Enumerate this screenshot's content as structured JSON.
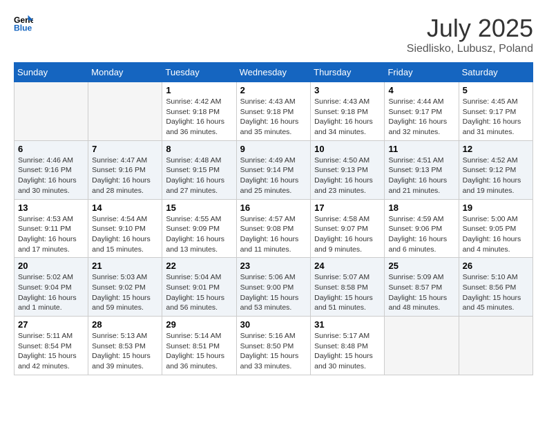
{
  "logo": {
    "line1": "General",
    "line2": "Blue"
  },
  "title": {
    "month_year": "July 2025",
    "location": "Siedlisko, Lubusz, Poland"
  },
  "days_of_week": [
    "Sunday",
    "Monday",
    "Tuesday",
    "Wednesday",
    "Thursday",
    "Friday",
    "Saturday"
  ],
  "weeks": [
    [
      {
        "day": "",
        "info": ""
      },
      {
        "day": "",
        "info": ""
      },
      {
        "day": "1",
        "info": "Sunrise: 4:42 AM\nSunset: 9:18 PM\nDaylight: 16 hours and 36 minutes."
      },
      {
        "day": "2",
        "info": "Sunrise: 4:43 AM\nSunset: 9:18 PM\nDaylight: 16 hours and 35 minutes."
      },
      {
        "day": "3",
        "info": "Sunrise: 4:43 AM\nSunset: 9:18 PM\nDaylight: 16 hours and 34 minutes."
      },
      {
        "day": "4",
        "info": "Sunrise: 4:44 AM\nSunset: 9:17 PM\nDaylight: 16 hours and 32 minutes."
      },
      {
        "day": "5",
        "info": "Sunrise: 4:45 AM\nSunset: 9:17 PM\nDaylight: 16 hours and 31 minutes."
      }
    ],
    [
      {
        "day": "6",
        "info": "Sunrise: 4:46 AM\nSunset: 9:16 PM\nDaylight: 16 hours and 30 minutes."
      },
      {
        "day": "7",
        "info": "Sunrise: 4:47 AM\nSunset: 9:16 PM\nDaylight: 16 hours and 28 minutes."
      },
      {
        "day": "8",
        "info": "Sunrise: 4:48 AM\nSunset: 9:15 PM\nDaylight: 16 hours and 27 minutes."
      },
      {
        "day": "9",
        "info": "Sunrise: 4:49 AM\nSunset: 9:14 PM\nDaylight: 16 hours and 25 minutes."
      },
      {
        "day": "10",
        "info": "Sunrise: 4:50 AM\nSunset: 9:13 PM\nDaylight: 16 hours and 23 minutes."
      },
      {
        "day": "11",
        "info": "Sunrise: 4:51 AM\nSunset: 9:13 PM\nDaylight: 16 hours and 21 minutes."
      },
      {
        "day": "12",
        "info": "Sunrise: 4:52 AM\nSunset: 9:12 PM\nDaylight: 16 hours and 19 minutes."
      }
    ],
    [
      {
        "day": "13",
        "info": "Sunrise: 4:53 AM\nSunset: 9:11 PM\nDaylight: 16 hours and 17 minutes."
      },
      {
        "day": "14",
        "info": "Sunrise: 4:54 AM\nSunset: 9:10 PM\nDaylight: 16 hours and 15 minutes."
      },
      {
        "day": "15",
        "info": "Sunrise: 4:55 AM\nSunset: 9:09 PM\nDaylight: 16 hours and 13 minutes."
      },
      {
        "day": "16",
        "info": "Sunrise: 4:57 AM\nSunset: 9:08 PM\nDaylight: 16 hours and 11 minutes."
      },
      {
        "day": "17",
        "info": "Sunrise: 4:58 AM\nSunset: 9:07 PM\nDaylight: 16 hours and 9 minutes."
      },
      {
        "day": "18",
        "info": "Sunrise: 4:59 AM\nSunset: 9:06 PM\nDaylight: 16 hours and 6 minutes."
      },
      {
        "day": "19",
        "info": "Sunrise: 5:00 AM\nSunset: 9:05 PM\nDaylight: 16 hours and 4 minutes."
      }
    ],
    [
      {
        "day": "20",
        "info": "Sunrise: 5:02 AM\nSunset: 9:04 PM\nDaylight: 16 hours and 1 minute."
      },
      {
        "day": "21",
        "info": "Sunrise: 5:03 AM\nSunset: 9:02 PM\nDaylight: 15 hours and 59 minutes."
      },
      {
        "day": "22",
        "info": "Sunrise: 5:04 AM\nSunset: 9:01 PM\nDaylight: 15 hours and 56 minutes."
      },
      {
        "day": "23",
        "info": "Sunrise: 5:06 AM\nSunset: 9:00 PM\nDaylight: 15 hours and 53 minutes."
      },
      {
        "day": "24",
        "info": "Sunrise: 5:07 AM\nSunset: 8:58 PM\nDaylight: 15 hours and 51 minutes."
      },
      {
        "day": "25",
        "info": "Sunrise: 5:09 AM\nSunset: 8:57 PM\nDaylight: 15 hours and 48 minutes."
      },
      {
        "day": "26",
        "info": "Sunrise: 5:10 AM\nSunset: 8:56 PM\nDaylight: 15 hours and 45 minutes."
      }
    ],
    [
      {
        "day": "27",
        "info": "Sunrise: 5:11 AM\nSunset: 8:54 PM\nDaylight: 15 hours and 42 minutes."
      },
      {
        "day": "28",
        "info": "Sunrise: 5:13 AM\nSunset: 8:53 PM\nDaylight: 15 hours and 39 minutes."
      },
      {
        "day": "29",
        "info": "Sunrise: 5:14 AM\nSunset: 8:51 PM\nDaylight: 15 hours and 36 minutes."
      },
      {
        "day": "30",
        "info": "Sunrise: 5:16 AM\nSunset: 8:50 PM\nDaylight: 15 hours and 33 minutes."
      },
      {
        "day": "31",
        "info": "Sunrise: 5:17 AM\nSunset: 8:48 PM\nDaylight: 15 hours and 30 minutes."
      },
      {
        "day": "",
        "info": ""
      },
      {
        "day": "",
        "info": ""
      }
    ]
  ]
}
